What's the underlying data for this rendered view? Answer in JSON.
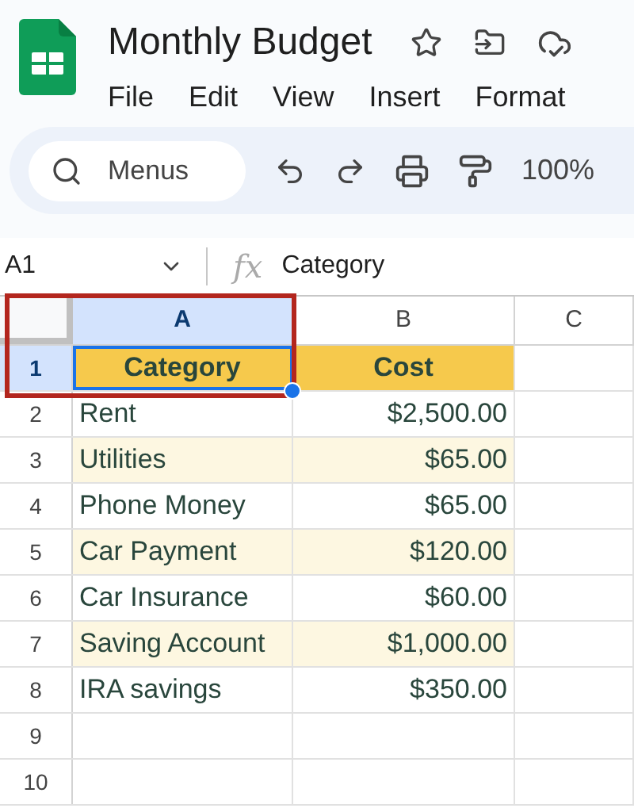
{
  "app": {
    "title": "Monthly Budget",
    "menu": [
      "File",
      "Edit",
      "View",
      "Insert",
      "Format"
    ]
  },
  "toolbar": {
    "search": {
      "placeholder": "Menus"
    },
    "zoom": "100%"
  },
  "formula_bar": {
    "cell_ref": "A1",
    "fx_label": "fx",
    "value": "Category"
  },
  "grid": {
    "columns": [
      {
        "label": "A",
        "selected": true
      },
      {
        "label": "B",
        "selected": false
      },
      {
        "label": "C",
        "selected": false
      }
    ],
    "rows": [
      {
        "number": "1",
        "kind": "header",
        "selected": true,
        "cells": [
          "Category",
          "Cost"
        ]
      },
      {
        "number": "2",
        "kind": "data",
        "selected": false,
        "banded": false,
        "cells": [
          "Rent",
          "$2,500.00"
        ]
      },
      {
        "number": "3",
        "kind": "data",
        "selected": false,
        "banded": true,
        "cells": [
          "Utilities",
          "$65.00"
        ]
      },
      {
        "number": "4",
        "kind": "data",
        "selected": false,
        "banded": false,
        "cells": [
          "Phone Money",
          "$65.00"
        ]
      },
      {
        "number": "5",
        "kind": "data",
        "selected": false,
        "banded": true,
        "cells": [
          "Car Payment",
          "$120.00"
        ]
      },
      {
        "number": "6",
        "kind": "data",
        "selected": false,
        "banded": false,
        "cells": [
          "Car Insurance",
          "$60.00"
        ]
      },
      {
        "number": "7",
        "kind": "data",
        "selected": false,
        "banded": true,
        "cells": [
          "Saving Account",
          "$1,000.00"
        ]
      },
      {
        "number": "8",
        "kind": "data",
        "selected": false,
        "banded": false,
        "cells": [
          "IRA savings",
          "$350.00"
        ]
      },
      {
        "number": "9",
        "kind": "empty",
        "selected": false,
        "cells": []
      },
      {
        "number": "10",
        "kind": "empty",
        "selected": false,
        "cells": []
      }
    ]
  }
}
